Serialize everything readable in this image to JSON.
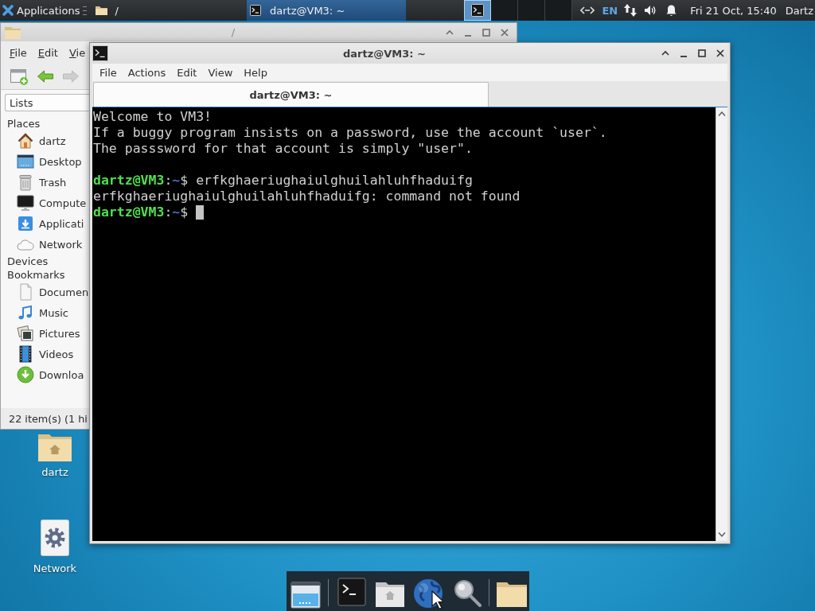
{
  "top_panel": {
    "applications_menu": {
      "label": "Applications"
    },
    "places_menu": {
      "label": "/"
    },
    "tasks": [
      {
        "label": "dartz@VM3: ~",
        "selected": true
      }
    ],
    "workspaces": [
      {
        "selected": true
      },
      {
        "selected": false
      },
      {
        "selected": false
      },
      {
        "selected": false
      }
    ],
    "keyboard_layout": "EN",
    "clock": "Fri 21 Oct, 15:40",
    "user": "Dartz"
  },
  "file_manager": {
    "title": "/",
    "menu": [
      "File",
      "Edit",
      "Vie"
    ],
    "toolbar": [
      {
        "kind": "new-window",
        "disabled": false
      },
      {
        "kind": "back",
        "disabled": false
      },
      {
        "kind": "forward",
        "disabled": true
      }
    ],
    "side_pane_view": "Lists",
    "sections": [
      {
        "title": "Places",
        "items": [
          {
            "label": "dartz",
            "kind": "home"
          },
          {
            "label": "Desktop",
            "kind": "desktop"
          },
          {
            "label": "Trash",
            "kind": "trash"
          },
          {
            "label": "Compute",
            "kind": "computer"
          },
          {
            "label": "Applicati",
            "kind": "applications"
          },
          {
            "label": "Network",
            "kind": "network"
          }
        ]
      },
      {
        "title": "Devices"
      },
      {
        "title": "Bookmarks",
        "items": [
          {
            "label": "Documen",
            "kind": "document"
          },
          {
            "label": "Music",
            "kind": "music"
          },
          {
            "label": "Pictures",
            "kind": "pictures"
          },
          {
            "label": "Videos",
            "kind": "videos"
          },
          {
            "label": "Downloa",
            "kind": "downloads"
          }
        ]
      }
    ],
    "status": "22 item(s) (1 hi"
  },
  "terminal": {
    "title": "dartz@VM3: ~",
    "menu": [
      "File",
      "Actions",
      "Edit",
      "View",
      "Help"
    ],
    "tabs": [
      {
        "label": "dartz@VM3: ~",
        "selected": true
      }
    ],
    "lines": [
      {
        "kind": "output",
        "text": "Welcome to VM3!"
      },
      {
        "kind": "output",
        "text": "If a buggy program insists on a password, use the account `user`."
      },
      {
        "kind": "output",
        "text": "The passsword for that account is simply \"user\"."
      },
      {
        "kind": "blank"
      },
      {
        "kind": "prompt",
        "user": "dartz@VM3",
        "separator": ":",
        "path": "~",
        "symbol": "$",
        "command": "erfkghaeriughaiulghuilahluhfhaduifg"
      },
      {
        "kind": "output",
        "text": "erfkghaeriughaiulghuilahluhfhaduifg: command not found"
      },
      {
        "kind": "prompt",
        "user": "dartz@VM3",
        "separator": ":",
        "path": "~",
        "symbol": "$",
        "cursor": true
      }
    ]
  },
  "desktop_icons": [
    {
      "label": "dartz",
      "kind": "home-folder"
    },
    {
      "label": "Network",
      "kind": "network"
    }
  ],
  "dock": {
    "items": [
      {
        "kind": "show-desktop"
      },
      {
        "kind": "separator"
      },
      {
        "kind": "terminal"
      },
      {
        "kind": "home-folder"
      },
      {
        "kind": "web-browser"
      },
      {
        "kind": "search"
      },
      {
        "kind": "separator"
      },
      {
        "kind": "folder"
      }
    ]
  }
}
